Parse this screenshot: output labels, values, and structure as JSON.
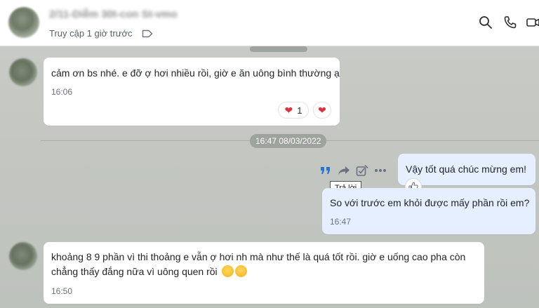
{
  "header": {
    "contact_name": "2/11-Diễm 30t-con St-vmo",
    "last_seen": "Truy cập 1 giờ trước"
  },
  "messages": [
    {
      "text": "cảm ơn bs nhé. e đỡ ợ hơi nhiều rồi, giờ e ăn uông bình thường ạ",
      "time": "16:06",
      "reaction_count": "1"
    },
    {
      "text": "Vậy tốt quá chúc mừng em!"
    },
    {
      "text": "So với trước em khỏi được mấy phần rồi em?",
      "time": "16:47"
    },
    {
      "text_line1": "khoảng 8 9 phần vì thi thoảng e vẫn ợ hơi nh mà như thế là quá tốt rồi. giờ e uống cao pha còn",
      "text_line2": "chẳng thấy đắng nữa vì uông quen rồi",
      "time": "16:50"
    }
  ],
  "date_separator": "16:47 08/03/2022",
  "tooltip": "Trả lời",
  "colors": {
    "my_bubble": "#e5efff",
    "their_bubble": "#ffffff",
    "heart": "#e0303a",
    "quote_icon": "#1a73e8"
  }
}
